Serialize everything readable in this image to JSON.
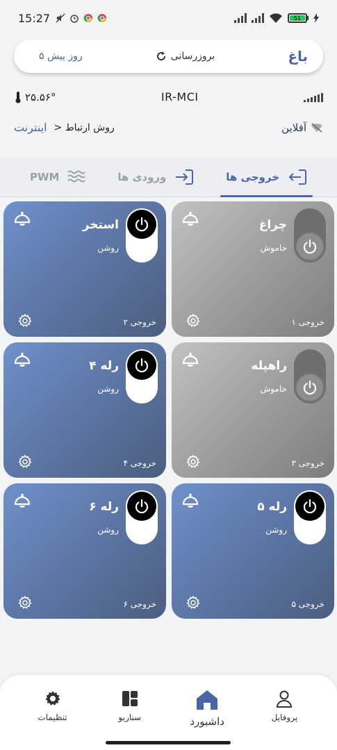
{
  "status_bar": {
    "time": "15:27",
    "battery": "51"
  },
  "header": {
    "title": "باغ",
    "refresh_label": "بروزرسانی",
    "last_update": "۵ روز پیش"
  },
  "info": {
    "temperature": "۲۵.۵۶°",
    "carrier": "IR-MCI",
    "connection_label": "روش ارتباط",
    "connection_value": "اینترنت",
    "chevron": ">",
    "status": "آفلاین"
  },
  "tabs": [
    {
      "label": "خروجی ها",
      "icon": "login-icon",
      "active": true
    },
    {
      "label": "ورودی ها",
      "icon": "input-icon",
      "active": false
    },
    {
      "label": "PWM",
      "icon": "waves-icon",
      "active": false
    }
  ],
  "outputs": [
    {
      "name": "چراغ",
      "state": "خاموش",
      "output": "خروجی ۱",
      "on": false
    },
    {
      "name": "استخر",
      "state": "روشن",
      "output": "خروجی ۲",
      "on": true
    },
    {
      "name": "راهپله",
      "state": "خاموش",
      "output": "خروجی ۳",
      "on": false
    },
    {
      "name": "رله ۴",
      "state": "روشن",
      "output": "خروجی ۴",
      "on": true
    },
    {
      "name": "رله ۵",
      "state": "روشن",
      "output": "خروجی ۵",
      "on": true
    },
    {
      "name": "رله ۶",
      "state": "روشن",
      "output": "خروجی ۶",
      "on": true
    }
  ],
  "nav": [
    {
      "label": "پروفایل",
      "icon": "person-icon",
      "active": false
    },
    {
      "label": "داشبورد",
      "icon": "home-icon",
      "active": true
    },
    {
      "label": "سناریو",
      "icon": "grid-icon",
      "active": false
    },
    {
      "label": "تنظیمات",
      "icon": "gear-icon",
      "active": false
    }
  ],
  "colors": {
    "accent": "#4a66a8",
    "card_on": "#5e78a8",
    "card_off": "#9e9e9e"
  }
}
